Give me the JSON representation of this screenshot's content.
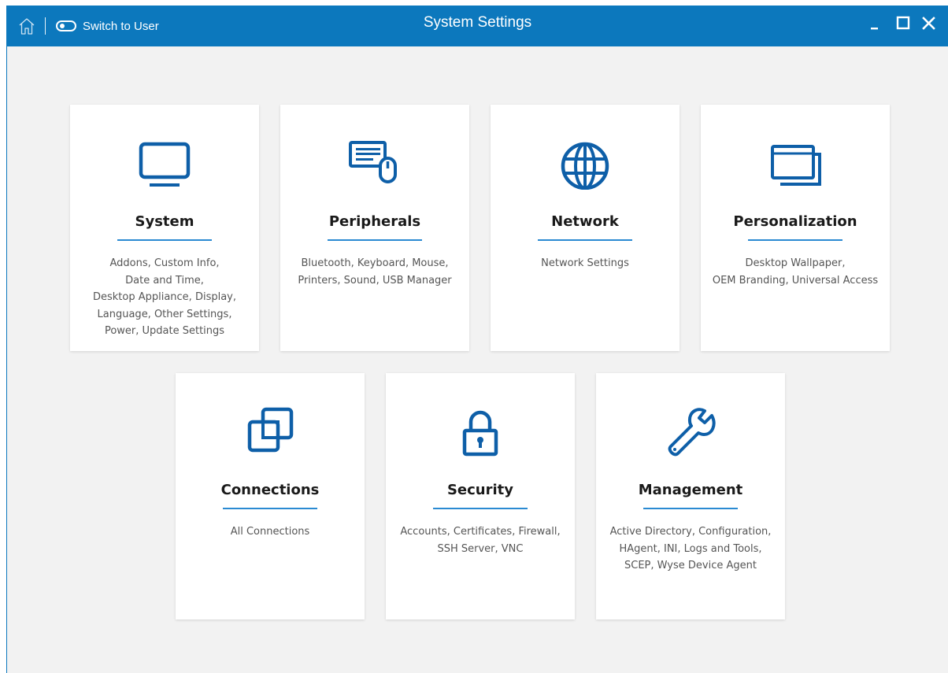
{
  "window": {
    "title": "System Settings",
    "switch_label": "Switch to User",
    "accent": "#0c78bd"
  },
  "cards": [
    {
      "title": "System",
      "desc_lines": [
        "Addons, Custom Info,",
        "Date and Time,",
        "Desktop Appliance, Display,",
        "Language, Other Settings,",
        "Power, Update Settings"
      ],
      "icon": "monitor-icon"
    },
    {
      "title": "Peripherals",
      "desc_lines": [
        "Bluetooth, Keyboard, Mouse,",
        "Printers, Sound, USB Manager"
      ],
      "icon": "keyboard-mouse-icon"
    },
    {
      "title": "Network",
      "desc_lines": [
        "Network Settings"
      ],
      "icon": "globe-icon"
    },
    {
      "title": "Personalization",
      "desc_lines": [
        "Desktop Wallpaper,",
        "OEM Branding, Universal Access"
      ],
      "icon": "windows-icon"
    },
    {
      "title": "Connections",
      "desc_lines": [
        "All Connections"
      ],
      "icon": "connections-icon"
    },
    {
      "title": "Security",
      "desc_lines": [
        "Accounts, Certificates, Firewall,",
        "SSH Server, VNC"
      ],
      "icon": "lock-icon"
    },
    {
      "title": "Management",
      "desc_lines": [
        "Active Directory, Configuration,",
        "HAgent, INI, Logs and Tools,",
        "SCEP, Wyse Device Agent"
      ],
      "icon": "wrench-icon"
    }
  ]
}
